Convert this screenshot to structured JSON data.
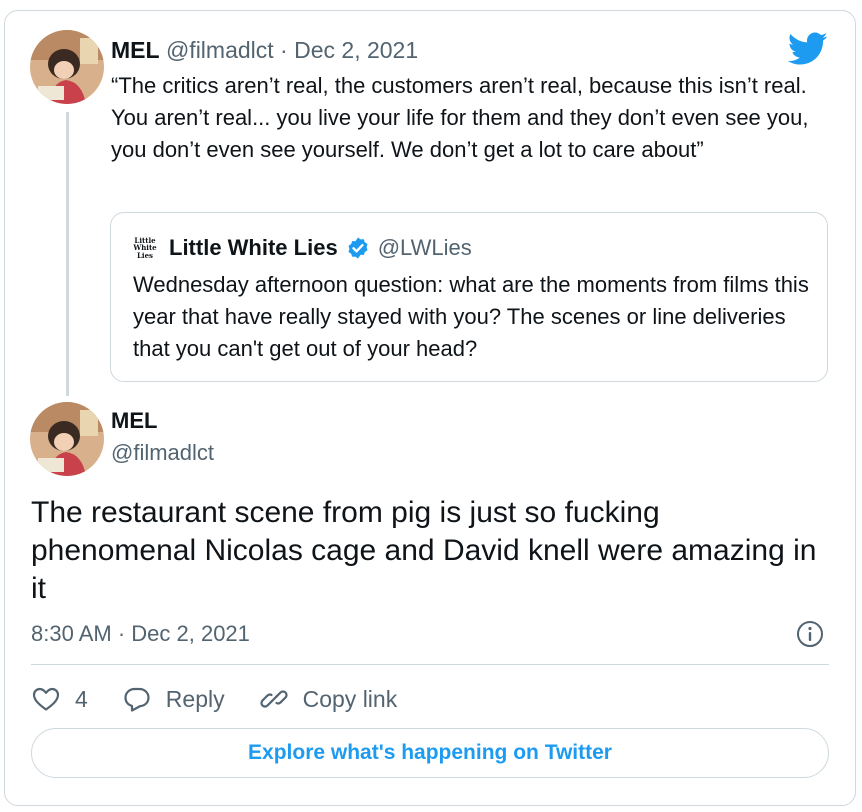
{
  "colors": {
    "accent": "#1d9bf0",
    "text": "#0f1419",
    "secondary": "#536471",
    "border": "#cfd9de"
  },
  "reply_tweet": {
    "author_name": "MEL",
    "author_handle": "@filmadlct",
    "separator": " · ",
    "date": "Dec 2, 2021",
    "text": "“The critics aren’t real, the customers aren’t real, because this isn’t real. You aren’t real... you live your life for them and they don’t even see you, you don’t even see yourself. We don’t get a lot to care about”"
  },
  "quoted_tweet": {
    "logo_lines": [
      "Little",
      "White",
      "Lies"
    ],
    "author_name": "Little White Lies",
    "verified": true,
    "author_handle": "@LWLies",
    "text": "Wednesday afternoon question: what are the moments from films this year that have really stayed with you? The scenes or line deliveries that you can't get out of your head?"
  },
  "main_tweet": {
    "author_name": "MEL",
    "author_handle": "@filmadlct",
    "text": "The restaurant scene from pig is just so fucking phenomenal Nicolas cage and David knell were amazing in it",
    "timestamp": "8:30 AM · Dec 2, 2021"
  },
  "actions": {
    "like_count": "4",
    "reply_label": "Reply",
    "copy_link_label": "Copy link"
  },
  "explore_button": {
    "label": "Explore what's happening on Twitter"
  },
  "icons": [
    "twitter-bird-icon",
    "verified-badge-icon",
    "info-icon",
    "heart-icon",
    "reply-bubble-icon",
    "link-icon"
  ]
}
